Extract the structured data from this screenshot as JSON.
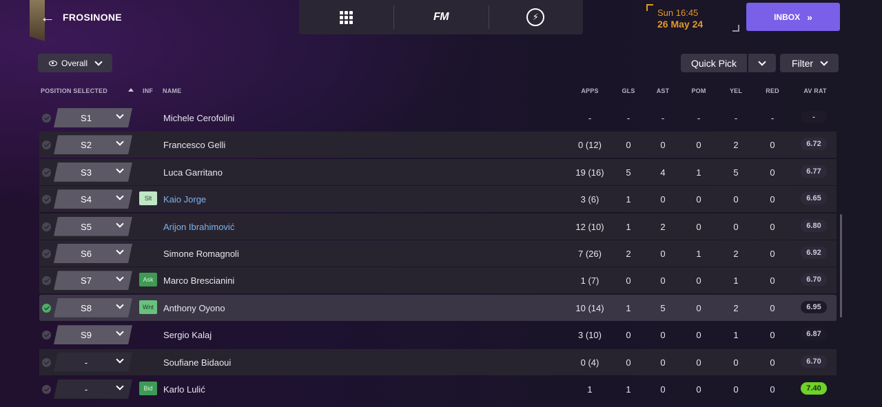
{
  "header": {
    "club_name": "FROSINONE",
    "fm_logo": "FM",
    "time": "Sun 16:45",
    "date": "26 May 24",
    "inbox_label": "INBOX"
  },
  "toolbar": {
    "view_label": "Overall",
    "quick_pick_label": "Quick Pick",
    "filter_label": "Filter"
  },
  "columns": {
    "position_selected": "POSITION SELECTED",
    "inf": "INF",
    "name": "NAME",
    "apps": "APPS",
    "gls": "GLS",
    "ast": "AST",
    "pom": "POM",
    "yel": "YEL",
    "red": "RED",
    "av_rat": "AV RAT"
  },
  "rows": [
    {
      "checked": false,
      "position": "S1",
      "inf": "",
      "name": "Michele Cerofolini",
      "link": false,
      "apps": "-",
      "gls": "-",
      "ast": "-",
      "pom": "-",
      "yel": "-",
      "red": "-",
      "av_rat": "-"
    },
    {
      "checked": false,
      "position": "S2",
      "inf": "",
      "name": "Francesco Gelli",
      "link": false,
      "apps": "0 (12)",
      "gls": "0",
      "ast": "0",
      "pom": "0",
      "yel": "2",
      "red": "0",
      "av_rat": "6.72"
    },
    {
      "checked": false,
      "position": "S3",
      "inf": "",
      "name": "Luca Garritano",
      "link": false,
      "apps": "19 (16)",
      "gls": "5",
      "ast": "4",
      "pom": "1",
      "yel": "5",
      "red": "0",
      "av_rat": "6.77"
    },
    {
      "checked": false,
      "position": "S4",
      "inf": "Slt",
      "name": "Kaio Jorge",
      "link": true,
      "apps": "3 (6)",
      "gls": "1",
      "ast": "0",
      "pom": "0",
      "yel": "0",
      "red": "0",
      "av_rat": "6.65"
    },
    {
      "checked": false,
      "position": "S5",
      "inf": "",
      "name": "Arijon Ibrahimović",
      "link": true,
      "apps": "12 (10)",
      "gls": "1",
      "ast": "2",
      "pom": "0",
      "yel": "0",
      "red": "0",
      "av_rat": "6.80"
    },
    {
      "checked": false,
      "position": "S6",
      "inf": "",
      "name": "Simone Romagnoli",
      "link": false,
      "apps": "7 (26)",
      "gls": "2",
      "ast": "0",
      "pom": "1",
      "yel": "2",
      "red": "0",
      "av_rat": "6.92"
    },
    {
      "checked": false,
      "position": "S7",
      "inf": "Ask",
      "name": "Marco Brescianini",
      "link": false,
      "apps": "1 (7)",
      "gls": "0",
      "ast": "0",
      "pom": "0",
      "yel": "1",
      "red": "0",
      "av_rat": "6.70"
    },
    {
      "checked": true,
      "position": "S8",
      "inf": "Wnt",
      "name": "Anthony Oyono",
      "link": false,
      "apps": "10 (14)",
      "gls": "1",
      "ast": "5",
      "pom": "0",
      "yel": "2",
      "red": "0",
      "av_rat": "6.95"
    },
    {
      "checked": false,
      "position": "S9",
      "inf": "",
      "name": "Sergio Kalaj",
      "link": false,
      "apps": "3 (10)",
      "gls": "0",
      "ast": "0",
      "pom": "0",
      "yel": "1",
      "red": "0",
      "av_rat": "6.87"
    },
    {
      "checked": false,
      "position": "-",
      "inf": "",
      "name": "Soufiane Bidaoui",
      "link": false,
      "apps": "0 (4)",
      "gls": "0",
      "ast": "0",
      "pom": "0",
      "yel": "0",
      "red": "0",
      "av_rat": "6.70"
    },
    {
      "checked": false,
      "position": "-",
      "inf": "Bid",
      "name": "Karlo Lulić",
      "link": false,
      "apps": "1",
      "gls": "1",
      "ast": "0",
      "pom": "0",
      "yel": "0",
      "red": "0",
      "av_rat": "7.40"
    }
  ],
  "colors": {
    "accent_purple": "#7a5fe8",
    "date_orange": "#e09a2a",
    "link_blue": "#7fb2ee",
    "rating_green": "#6ed22a"
  }
}
